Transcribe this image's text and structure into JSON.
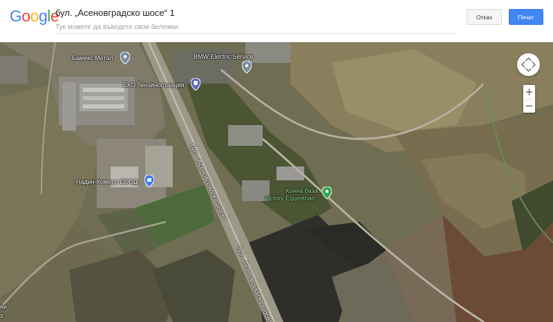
{
  "header": {
    "logo_text": "Google",
    "title": "бул. „Асеновградско шосе“ 1",
    "notes_placeholder": "Тук можете да въведете свои бележки.",
    "cancel_label": "Отказ",
    "print_label": "Печат"
  },
  "map": {
    "pois": [
      {
        "label": "Бамекс Метал",
        "icon": "pin-icon"
      },
      {
        "label": "BMW Electric Service",
        "icon": "pin-icon"
      },
      {
        "label": "ЕКО бензиностанция",
        "icon": "gas-station-icon"
      },
      {
        "label": "Надин-Комерс ЕООД",
        "icon": "shopping-bag-icon"
      },
      {
        "label": "Конна база",
        "icon": "park-pin-icon"
      },
      {
        "label": "Victory Equestrian",
        "icon": "park-pin-icon"
      }
    ],
    "road_label_1": "бул. „Асеновградско шосе“",
    "road_label_2": "бул. „Асеновградско шосе“",
    "edge_text_1": "ни",
    "edge_text_2": "з"
  },
  "controls": {
    "zoom_in": "+",
    "zoom_out": "−"
  }
}
